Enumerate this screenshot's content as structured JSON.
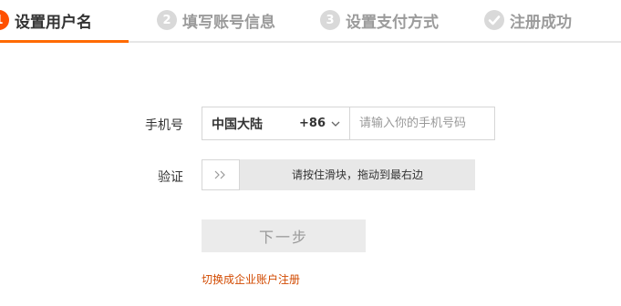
{
  "steps": [
    {
      "number": "1",
      "label": "设置用户名",
      "state": "active"
    },
    {
      "number": "2",
      "label": "填写账号信息",
      "state": "pending"
    },
    {
      "number": "3",
      "label": "设置支付方式",
      "state": "pending"
    },
    {
      "number": "",
      "label": "注册成功",
      "state": "final",
      "icon": "check-icon"
    }
  ],
  "form": {
    "phone_label": "手机号",
    "country_name": "中国大陆",
    "country_code": "+86",
    "phone_placeholder": "请输入你的手机号码",
    "phone_value": "",
    "verify_label": "验证",
    "slider_text": "请按住滑块，拖动到最右边",
    "slider_progress": 0,
    "next_button": "下一步",
    "switch_link": "切换成企业账户注册"
  },
  "colors": {
    "accent": "#ff5000",
    "link": "#d24a00",
    "inactive": "#d9d9d9"
  }
}
